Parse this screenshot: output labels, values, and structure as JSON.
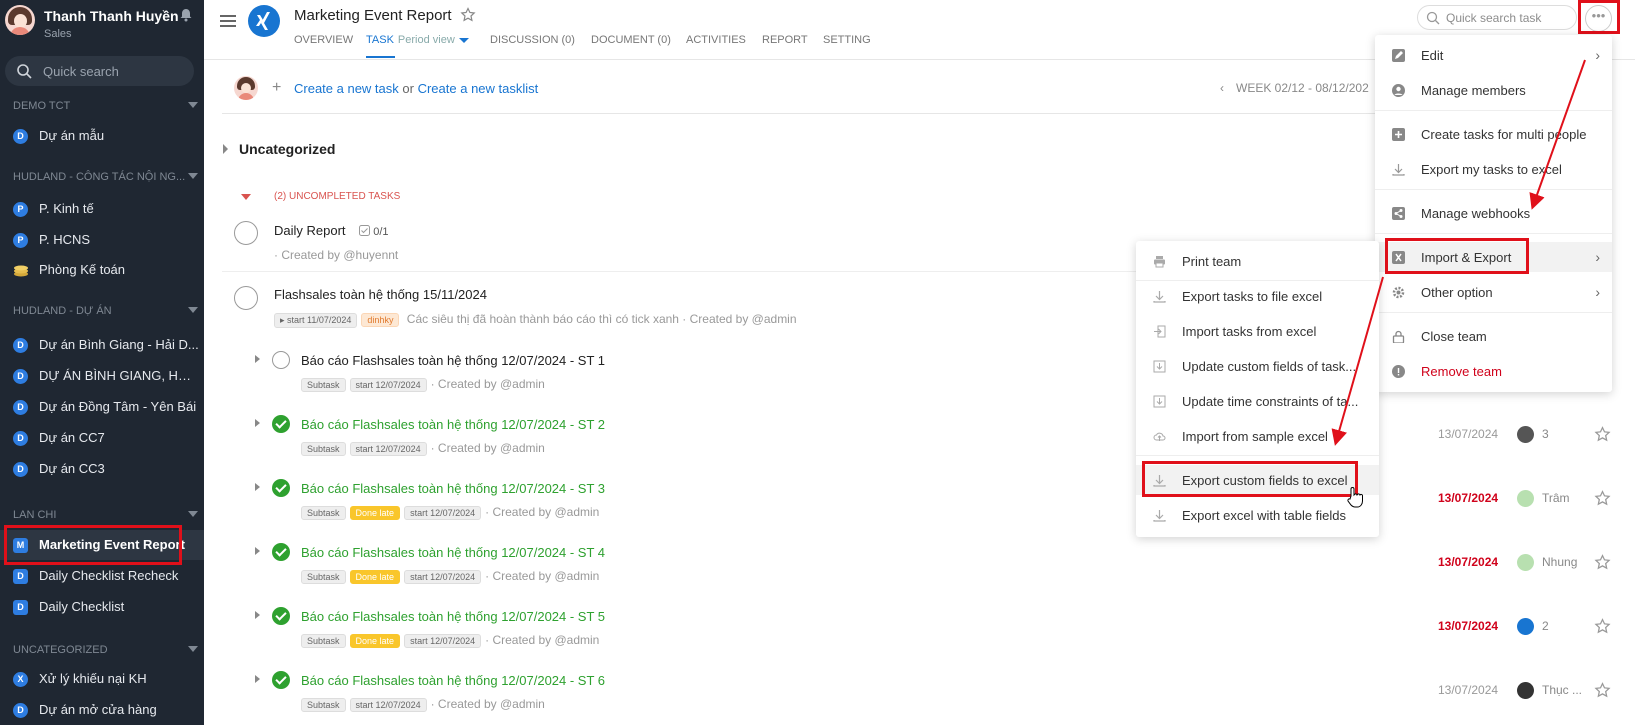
{
  "sidebar": {
    "user_name": "Thanh Thanh Huyền",
    "user_role": "Sales",
    "search_placeholder": "Quick search",
    "sections": [
      {
        "title": "DEMO TCT",
        "items": [
          {
            "badge": "D",
            "label": "Dự án mẫu"
          }
        ]
      },
      {
        "title": "HUDLAND - CÔNG TÁC NỘI NG...",
        "items": [
          {
            "badge": "P",
            "label": "P. Kinh tế"
          },
          {
            "badge": "P",
            "label": "P. HCNS"
          },
          {
            "badge": "",
            "label": "Phòng Kế toán"
          }
        ]
      },
      {
        "title": "HUDLAND - DỰ ÁN",
        "items": [
          {
            "badge": "D",
            "label": "Dự án Bình Giang - Hải D..."
          },
          {
            "badge": "D",
            "label": "DỰ ÁN BÌNH GIANG, HẢI ..."
          },
          {
            "badge": "D",
            "label": "Dự án Đồng Tâm - Yên Bái"
          },
          {
            "badge": "D",
            "label": "Dự án CC7"
          },
          {
            "badge": "D",
            "label": "Dự án CC3"
          }
        ]
      },
      {
        "title": "LAN CHI",
        "items": [
          {
            "badge": "M",
            "label": "Marketing Event Report"
          },
          {
            "badge": "D",
            "label": "Daily Checklist Recheck"
          },
          {
            "badge": "D",
            "label": "Daily Checklist"
          }
        ]
      },
      {
        "title": "UNCATEGORIZED",
        "items": [
          {
            "badge": "X",
            "label": "Xử lý khiếu nại KH"
          },
          {
            "badge": "D",
            "label": "Dự án mở cửa hàng"
          }
        ]
      }
    ]
  },
  "header": {
    "title": "Marketing Event Report",
    "tabs": [
      "OVERVIEW",
      "TASK",
      "Period view",
      "DISCUSSION (0)",
      "DOCUMENT (0)",
      "ACTIVITIES",
      "REPORT",
      "SETTING"
    ],
    "search_placeholder": "Quick search task",
    "more_label": "•••"
  },
  "toolbar": {
    "create_task": "Create a new task",
    "or": "or",
    "create_tasklist": "Create a new tasklist",
    "week": "WEEK 02/12 - 08/12/202"
  },
  "group": {
    "title": "Uncategorized",
    "uncompleted_label": "(2) UNCOMPLETED TASKS"
  },
  "tasks": [
    {
      "title": "Daily Report",
      "subcount": "0/1",
      "meta": "· Created by @huyennt"
    },
    {
      "title": "Flashsales toàn hệ thống 15/11/2024",
      "chips": [
        "start 11/07/2024",
        "dinhky"
      ],
      "meta": "Các siêu thị đã hoàn thành báo cáo thì có tick xanh · Created by @admin"
    }
  ],
  "subtasks": [
    {
      "title": "Báo cáo Flashsales toàn hệ thống 12/07/2024 - ST 1",
      "done": false,
      "chips": [
        "Subtask",
        "start 12/07/2024"
      ],
      "meta": "· Created by @admin",
      "date": "",
      "assignee": ""
    },
    {
      "title": "Báo cáo Flashsales toàn hệ thống 12/07/2024 - ST 2",
      "done": true,
      "chips": [
        "Subtask",
        "start 12/07/2024"
      ],
      "meta": "· Created by @admin",
      "date": "13/07/2024",
      "assignee": "3"
    },
    {
      "title": "Báo cáo Flashsales toàn hệ thống 12/07/2024 - ST 3",
      "done": true,
      "chips": [
        "Subtask",
        "Done late",
        "start 12/07/2024"
      ],
      "meta": "· Created by @admin",
      "date": "13/07/2024",
      "assignee": "Trâm"
    },
    {
      "title": "Báo cáo Flashsales toàn hệ thống 12/07/2024 - ST 4",
      "done": true,
      "chips": [
        "Subtask",
        "Done late",
        "start 12/07/2024"
      ],
      "meta": "· Created by @admin",
      "date": "13/07/2024",
      "assignee": "Nhung"
    },
    {
      "title": "Báo cáo Flashsales toàn hệ thống 12/07/2024 - ST 5",
      "done": true,
      "chips": [
        "Subtask",
        "Done late",
        "start 12/07/2024"
      ],
      "meta": "· Created by @admin",
      "date": "13/07/2024",
      "assignee": "2"
    },
    {
      "title": "Báo cáo Flashsales toàn hệ thống 12/07/2024 - ST 6",
      "done": true,
      "chips": [
        "Subtask",
        "start 12/07/2024"
      ],
      "meta": "· Created by @admin",
      "date": "13/07/2024",
      "assignee": "Thục ..."
    }
  ],
  "main_menu": [
    "Edit",
    "Manage members",
    "Create tasks for multi people",
    "Export my tasks to excel",
    "Manage webhooks",
    "Import & Export",
    "Other option",
    "Close team",
    "Remove team"
  ],
  "sub_menu": [
    "Print team",
    "Export tasks to file excel",
    "Import tasks from excel",
    "Update custom fields of task...",
    "Update time constraints of ta...",
    "Import from sample excel",
    "Export custom fields to excel",
    "Export excel with table fields"
  ],
  "colors": {
    "sidebar_bg": "#1f2732",
    "accent": "#1875d1",
    "done_green": "#2ea12f",
    "late_red": "#d0021b",
    "highlight_red": "#e0101a"
  }
}
